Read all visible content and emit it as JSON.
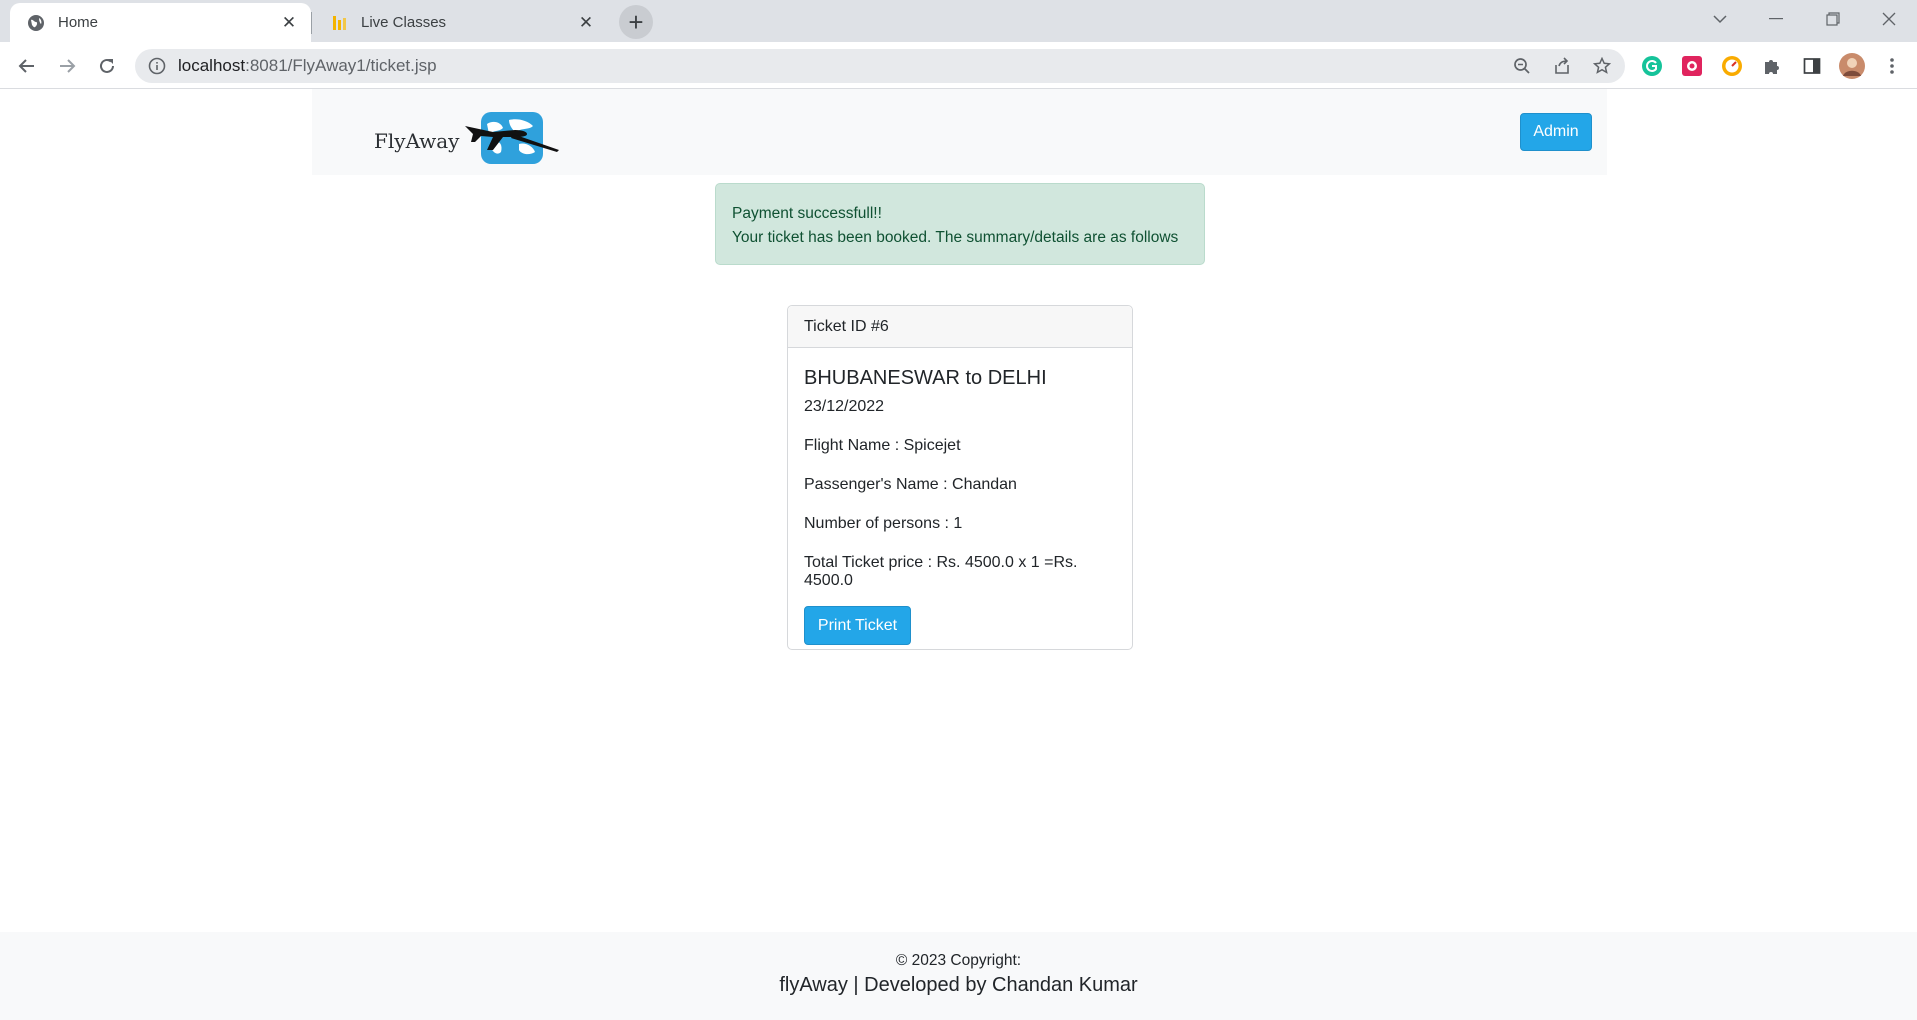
{
  "browser": {
    "tabs": [
      {
        "label": "Home",
        "active": true
      },
      {
        "label": "Live Classes",
        "active": false
      }
    ],
    "address": {
      "host": "localhost",
      "path": ":8081/FlyAway1/ticket.jsp"
    }
  },
  "navbar": {
    "brand": "FlyAway",
    "admin_label": "Admin"
  },
  "alert": {
    "line1": "Payment successfull!!",
    "line2": "Your ticket has been booked. The summary/details are as follows"
  },
  "ticket": {
    "header": "Ticket ID #6",
    "route": "BHUBANESWAR to DELHI",
    "date": "23/12/2022",
    "flight": "Flight Name : Spicejet",
    "passenger": "Passenger's Name : Chandan",
    "persons": "Number of persons : 1",
    "price": "Total Ticket price : Rs. 4500.0 x 1 =Rs. 4500.0",
    "print_label": "Print Ticket"
  },
  "footer": {
    "copyright": "© 2023 Copyright:",
    "credit": "flyAway | Developed by Chandan Kumar"
  },
  "colors": {
    "primary": "#23a6e8",
    "alert_bg": "#d1e7dd",
    "alert_text": "#0f5132"
  }
}
